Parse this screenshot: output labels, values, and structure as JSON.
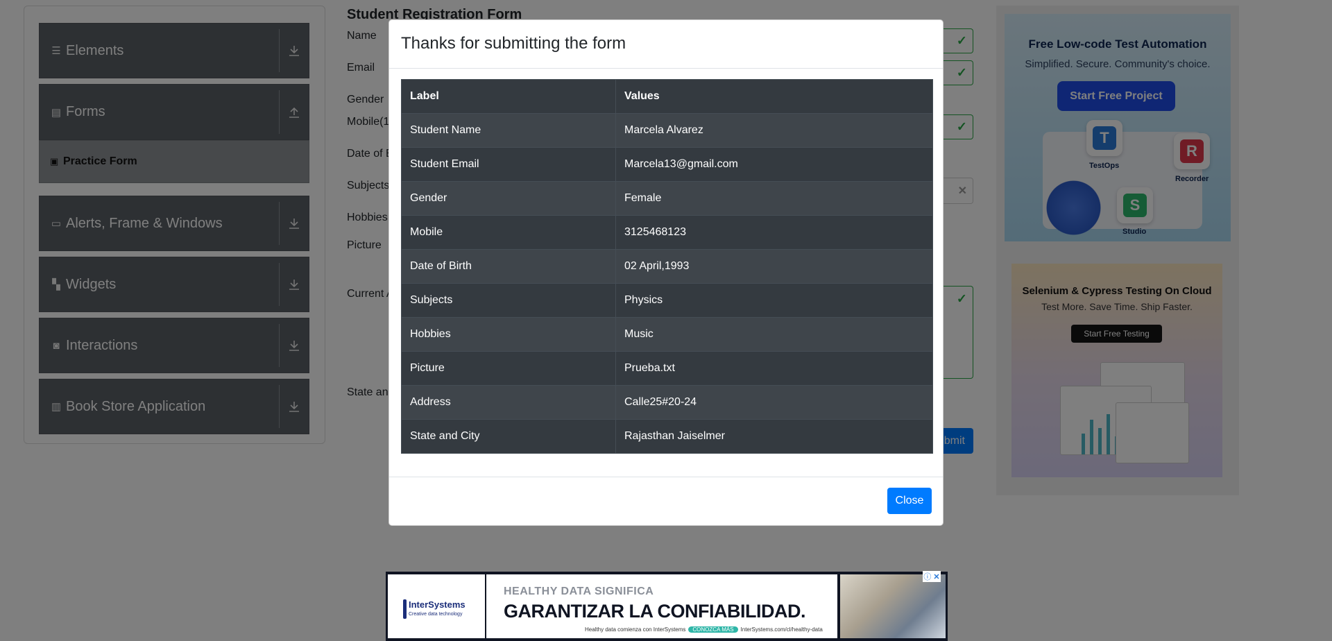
{
  "sidebar": {
    "groups": [
      {
        "label": "Elements",
        "icon": "menu-icon"
      },
      {
        "label": "Forms",
        "icon": "document-icon"
      },
      {
        "label": "Alerts, Frame & Windows",
        "icon": "window-icon"
      },
      {
        "label": "Widgets",
        "icon": "widgets-icon"
      },
      {
        "label": "Interactions",
        "icon": "interactions-icon"
      },
      {
        "label": "Book Store Application",
        "icon": "books-icon"
      }
    ],
    "active_item": "Practice Form"
  },
  "form": {
    "title": "Student Registration Form",
    "labels": {
      "name": "Name",
      "email": "Email",
      "gender": "Gender",
      "mobile": "Mobile(1",
      "dob": "Date of B",
      "subjects": "Subjects",
      "hobbies": "Hobbies",
      "picture": "Picture",
      "address": "Current A",
      "state": "State and"
    },
    "submit_label": "bmit"
  },
  "modal": {
    "title": "Thanks for submitting the form",
    "headers": [
      "Label",
      "Values"
    ],
    "rows": [
      [
        "Student Name",
        "Marcela Alvarez"
      ],
      [
        "Student Email",
        "Marcela13@gmail.com"
      ],
      [
        "Gender",
        "Female"
      ],
      [
        "Mobile",
        "3125468123"
      ],
      [
        "Date of Birth",
        "02 April,1993"
      ],
      [
        "Subjects",
        "Physics"
      ],
      [
        "Hobbies",
        "Music"
      ],
      [
        "Picture",
        "Prueba.txt"
      ],
      [
        "Address",
        "Calle25#20-24"
      ],
      [
        "State and City",
        "Rajasthan Jaiselmer"
      ]
    ],
    "close_label": "Close"
  },
  "ads": {
    "katalon": {
      "title": "Free Low-code Test Automation",
      "subtitle": "Simplified. Secure. Community's choice.",
      "button": "Start Free Project",
      "tiles": [
        "TestOps",
        "Recorder",
        "Studio"
      ]
    },
    "lambdatest": {
      "title": "Selenium & Cypress Testing On Cloud",
      "subtitle": "Test More. Save Time. Ship Faster.",
      "button": "Start Free Testing"
    },
    "intersystems": {
      "brand": "InterSystems",
      "tagline": "Creative data technology",
      "line1": "HEALTHY DATA SIGNIFICA",
      "line2": "GARANTIZAR LA CONFIABILIDAD.",
      "line3": "Healthy data comienza con InterSystems",
      "pill": "CONOZCA MÁS",
      "url": "InterSystems.com/cl/healthy-data"
    }
  },
  "colors": {
    "primary": "#007bff",
    "valid": "#28a745",
    "sidebar_group": "#5b6167",
    "table_dark": "#343a40"
  }
}
